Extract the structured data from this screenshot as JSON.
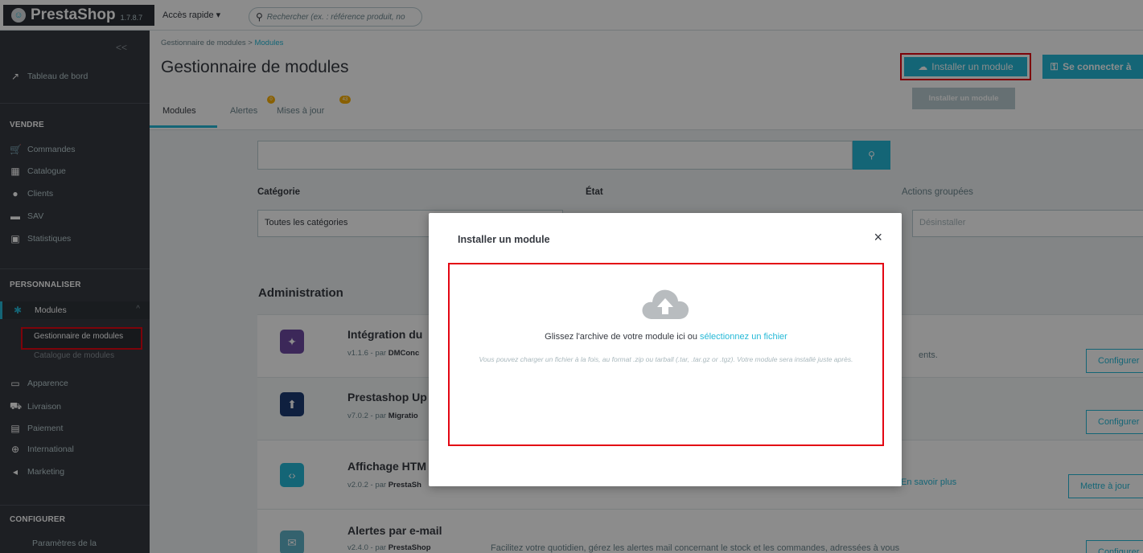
{
  "topbar": {
    "logo_text": "PrestaShop",
    "version": "1.7.8.7",
    "quick_access": "Accès rapide ▾",
    "search_placeholder": "Rechercher (ex. : référence produit, no"
  },
  "sidebar": {
    "collapse": "<<",
    "dashboard": "Tableau de bord",
    "sell_section": "VENDRE",
    "sell_items": [
      "Commandes",
      "Catalogue",
      "Clients",
      "SAV",
      "Statistiques"
    ],
    "customize_section": "PERSONNALISER",
    "modules": "Modules",
    "module_manager": "Gestionnaire de modules",
    "module_catalog": "Catalogue de modules",
    "customize_items": [
      "Apparence",
      "Livraison",
      "Paiement",
      "International",
      "Marketing"
    ],
    "configure_section": "CONFIGURER",
    "settings": "Paramètres de la"
  },
  "header": {
    "breadcrumb_parent": "Gestionnaire de modules",
    "breadcrumb_sep": ">",
    "breadcrumb_current": "Modules",
    "title": "Gestionnaire de modules",
    "install_button": "Installer un module",
    "connect_button": "Se connecter à",
    "tooltip": "Installer un module",
    "tabs": [
      "Modules",
      "Alertes",
      "Mises à jour"
    ],
    "alerts_badge": "0",
    "updates_badge": "43"
  },
  "filters": {
    "category_label": "Catégorie",
    "category_value": "Toutes les catégories",
    "state_label": "État",
    "bulk_label": "Actions groupées",
    "bulk_value": "Désinstaller"
  },
  "section_title": "Administration",
  "modules": [
    {
      "name": "Intégration du",
      "meta_version": "v1.1.6 - par ",
      "meta_author": "DMConc",
      "desc": "ents.",
      "action": "Configurer",
      "color": "#6d4aa3"
    },
    {
      "name": "Prestashop Up",
      "meta_version": "v7.0.2 - par ",
      "meta_author": "Migratio",
      "desc": "",
      "action": "Configurer",
      "color": "#1d3b73"
    },
    {
      "name": "Affichage HTM",
      "meta_version": "v2.0.2 - par ",
      "meta_author": "PrestaSh",
      "desc": "",
      "link": "En savoir plus",
      "action": "Mettre à jour",
      "color": "#25b9d7"
    },
    {
      "name": "Alertes par e-mail",
      "meta_version": "v2.4.0 - par ",
      "meta_author": "PrestaShop",
      "desc": "Facilitez votre quotidien, gérez les alertes mail concernant le stock et les commandes, adressées à vous",
      "action": "Configurer",
      "color": "#5fb3c9"
    }
  ],
  "modal": {
    "title": "Installer un module",
    "close": "×",
    "drop_text": "Glissez l'archive de votre module ici ou ",
    "drop_link": "sélectionnez un fichier",
    "hint": "Vous pouvez charger un fichier à la fois, au format .zip ou tarball (.tar, .tar.gz or .tgz). Votre module sera installé juste après."
  }
}
